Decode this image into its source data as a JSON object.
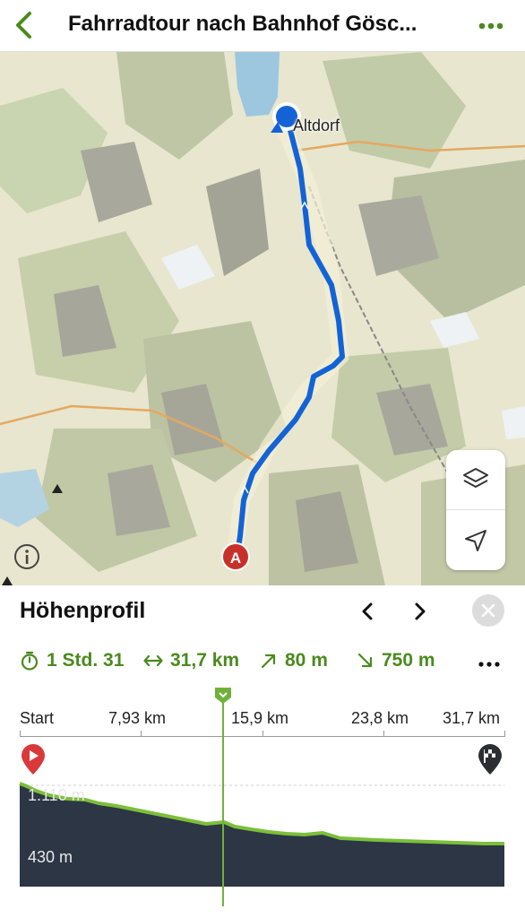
{
  "header": {
    "title": "Fahrradtour nach Bahnhof Gösc...",
    "back_icon": "chevron-left-icon",
    "more_icon": "more-dots-icon",
    "accent": "#4b8a1e"
  },
  "map": {
    "place_label": "Altdorf",
    "start_badge": "A",
    "route_color": "#1463d6",
    "controls": [
      "layers-icon",
      "locate-arrow-icon"
    ],
    "info_icon": "info-icon"
  },
  "panel": {
    "title": "Höhenprofil",
    "prev_icon": "chevron-left-icon",
    "next_icon": "chevron-right-icon",
    "close_icon": "close-icon",
    "stats": {
      "duration": "1 Std. 31",
      "distance": "31,7 km",
      "ascent": "80 m",
      "descent": "750 m"
    }
  },
  "profile": {
    "axis_labels": [
      "Start",
      "7,93 km",
      "15,9 km",
      "23,8 km",
      "31,7 km"
    ],
    "elevation_labels": [
      "1.110 m",
      "430 m"
    ],
    "start_icon": "play-flag-icon",
    "finish_icon": "finish-flag-icon",
    "cursor_fraction": 0.42,
    "profile_color": "#2c3645",
    "line_color": "#7cbf3a"
  }
}
